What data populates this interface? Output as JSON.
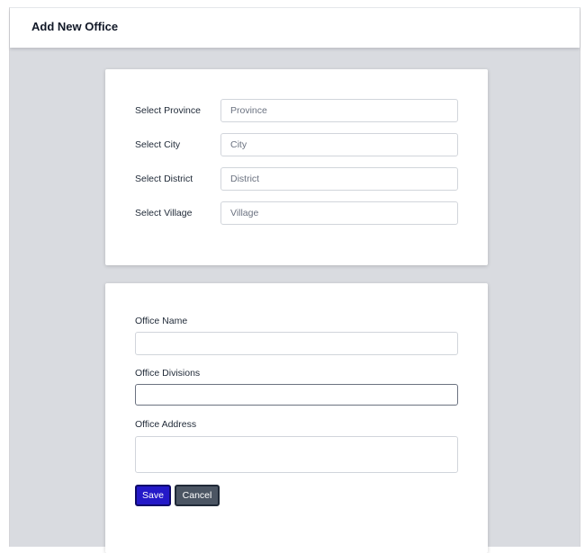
{
  "header": {
    "title": "Add New Office"
  },
  "location": {
    "rows": [
      {
        "label": "Select Province",
        "placeholder": "Province"
      },
      {
        "label": "Select City",
        "placeholder": "City"
      },
      {
        "label": "Select District",
        "placeholder": "District"
      },
      {
        "label": "Select Village",
        "placeholder": "Village"
      }
    ]
  },
  "office": {
    "name_label": "Office Name",
    "name_value": "",
    "divisions_label": "Office Divisions",
    "divisions_value": "",
    "address_label": "Office Address",
    "address_value": ""
  },
  "actions": {
    "save_label": "Save",
    "cancel_label": "Cancel"
  },
  "colors": {
    "save": "#2419c8",
    "cancel": "#4b5563",
    "background": "#d9dbe0"
  }
}
